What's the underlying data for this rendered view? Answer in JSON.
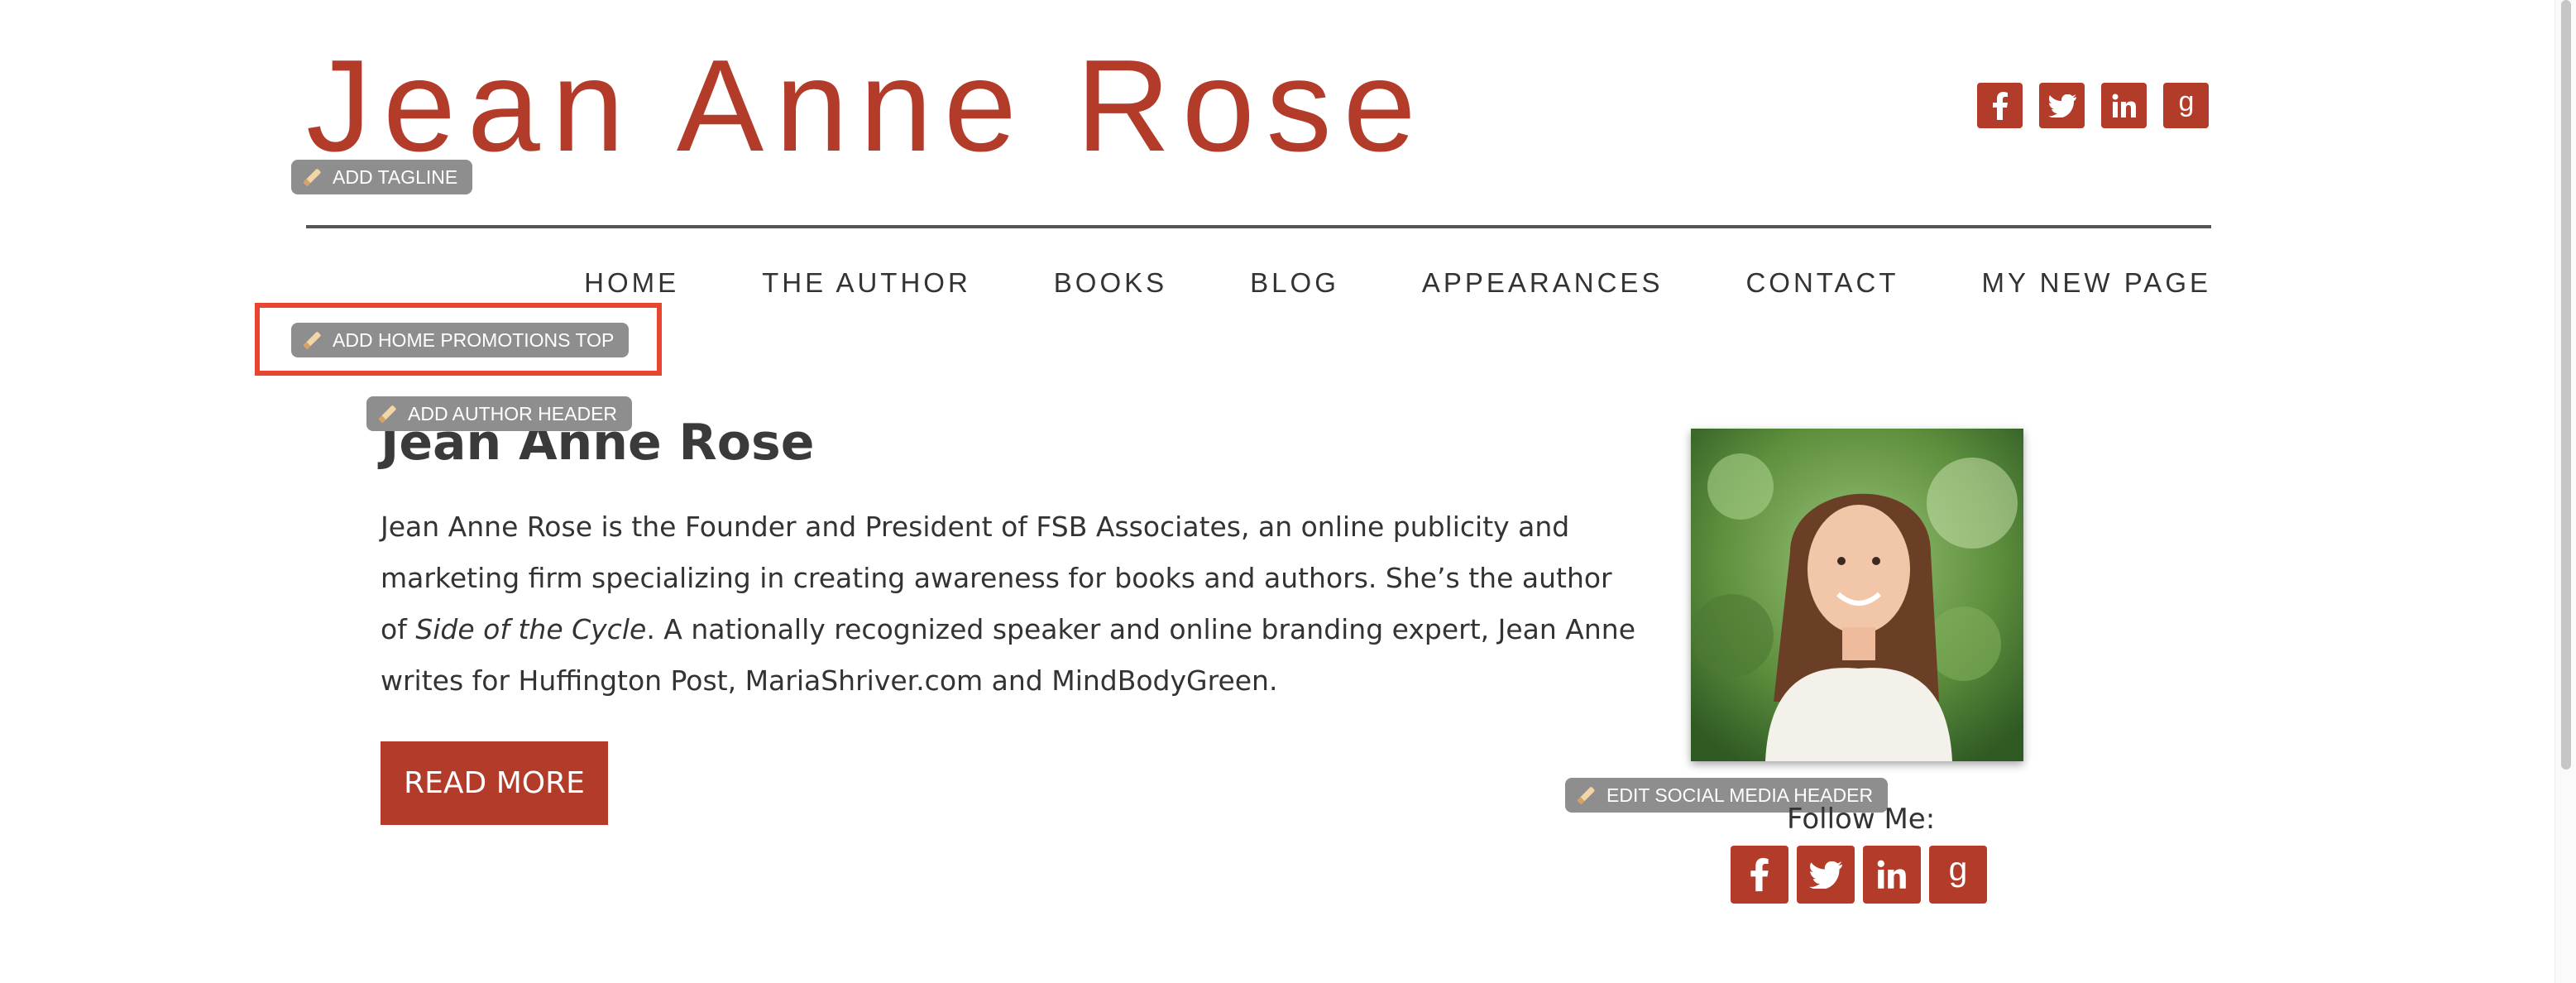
{
  "site": {
    "title": "Jean Anne Rose",
    "brand_color": "#b33b2a"
  },
  "edit_pills": {
    "tagline": "ADD TAGLINE",
    "home_promotions_top": "ADD HOME PROMOTIONS TOP",
    "author_header": "ADD AUTHOR HEADER",
    "social_media_header": "EDIT SOCIAL MEDIA HEADER"
  },
  "header_social": [
    {
      "icon": "facebook-icon"
    },
    {
      "icon": "twitter-icon"
    },
    {
      "icon": "linkedin-icon"
    },
    {
      "icon": "goodreads-icon"
    }
  ],
  "nav": {
    "items": [
      "HOME",
      "THE AUTHOR",
      "BOOKS",
      "BLOG",
      "APPEARANCES",
      "CONTACT",
      "MY NEW PAGE"
    ]
  },
  "author": {
    "name": "Jean Anne Rose",
    "bio_line1": "Jean Anne Rose is the Founder and President of FSB Associates, an online publicity and",
    "bio_line2": "marketing firm specializing in creating awareness for books and authors. She’s the author",
    "bio_line3_pre": "of ",
    "bio_line3_book": "Side of the Cycle",
    "bio_line3_post": ". A nationally recognized speaker and online branding expert, Jean Anne",
    "bio_line4": "writes for Huffington Post, MariaShriver.com and MindBodyGreen.",
    "read_more": "READ MORE"
  },
  "follow": {
    "label": "Follow Me:"
  }
}
